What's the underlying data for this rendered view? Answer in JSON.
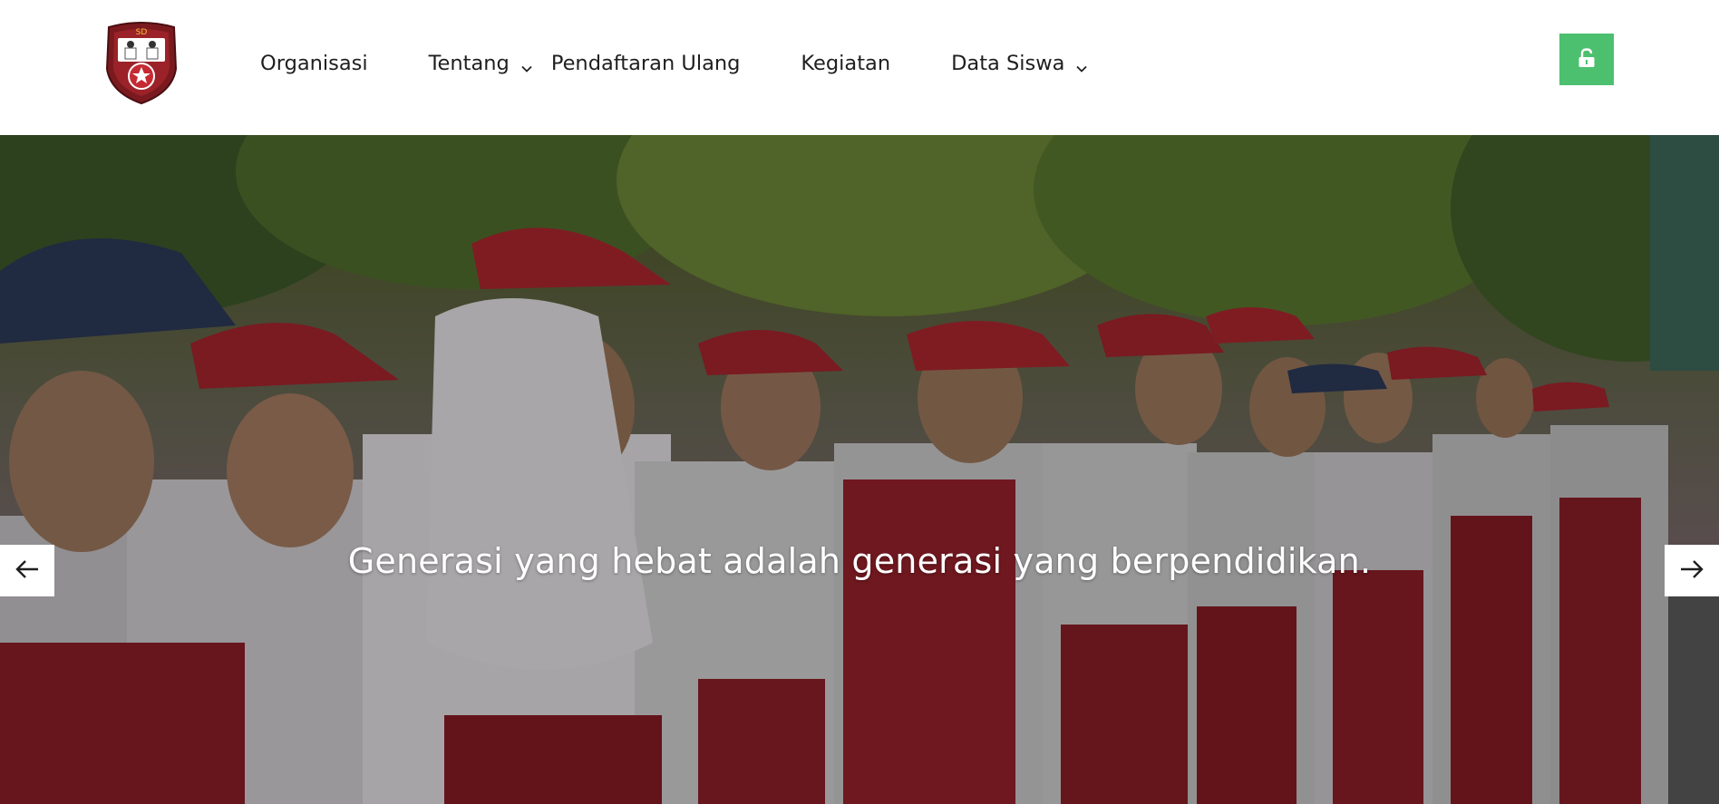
{
  "header": {
    "logo_icon": "school-crest-logo",
    "nav": [
      {
        "label": "Organisasi",
        "has_dropdown": false
      },
      {
        "label": "Tentang",
        "has_dropdown": true
      },
      {
        "label": "Pendaftaran Ulang",
        "has_dropdown": false
      },
      {
        "label": "Kegiatan",
        "has_dropdown": false
      },
      {
        "label": "Data Siswa",
        "has_dropdown": true
      }
    ],
    "login_icon": "unlock-icon",
    "colors": {
      "login_button": "#4cc06f"
    }
  },
  "hero": {
    "caption": "Generasi yang hebat adalah generasi yang berpendidikan.",
    "prev_icon": "arrow-left-icon",
    "next_icon": "arrow-right-icon"
  }
}
